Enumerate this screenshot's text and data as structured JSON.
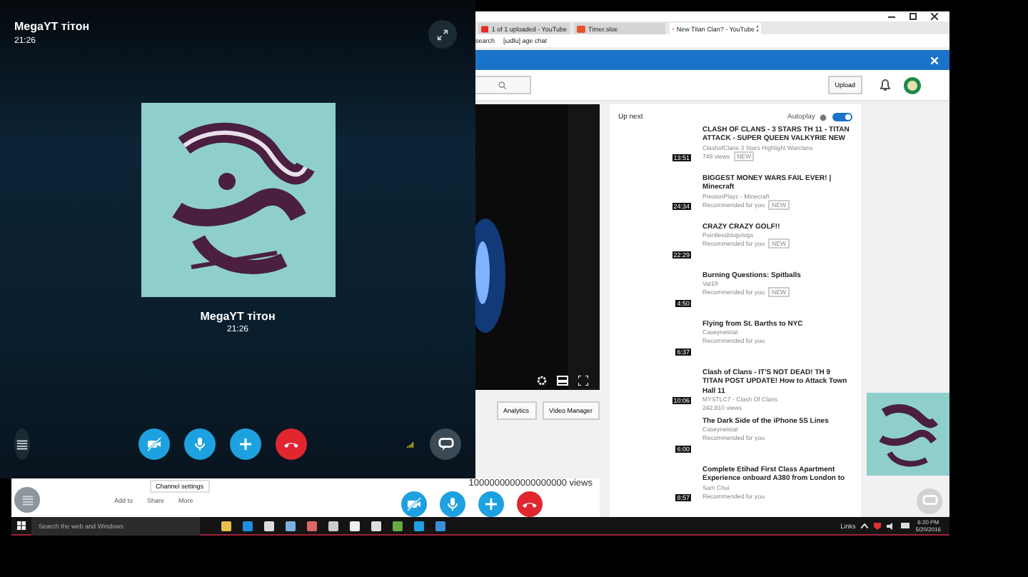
{
  "call": {
    "title": "MegaYT тітон",
    "time": "21:26",
    "name": "MegaYT тітон",
    "elapsed": "21:26",
    "camera_off": true,
    "mic_muted": false
  },
  "browser": {
    "tabs": [
      {
        "label": "1 of 1 uploaded - YouTube",
        "selected": false
      },
      {
        "label": "Timer.sloe",
        "selected": false
      },
      {
        "label": "New Titan Clan? - YouTube",
        "selected": true
      }
    ],
    "bookmarks": [
      "search",
      "[ωdlu] age chat"
    ],
    "youtube": {
      "upload": "Upload",
      "studio_buttons": [
        "Analytics",
        "Video Manager"
      ],
      "channel_settings": "Channel settings",
      "views": "1000000000000000000 views",
      "actions": [
        "Add to",
        "Share",
        "More"
      ],
      "up_next": {
        "title": "Up next",
        "autoplay": {
          "label": "Autoplay",
          "on": true
        },
        "videos": [
          {
            "title": "CLASH OF CLANS - 3 STARS TH 11 - TITAN ATTACK - SUPER QUEEN VALKYRIE NEW",
            "channel": "ClashofClans 3 Stars Highlight Warclans",
            "meta": "749 views",
            "badge": "NEW",
            "duration": "13:51"
          },
          {
            "title": "BIGGEST MONEY WARS FAIL EVER! | Minecraft",
            "channel": "PrestonPlayz - Minecraft",
            "meta": "Recommended for you",
            "badge": "NEW",
            "duration": "24:34"
          },
          {
            "title": "CRAZY CRAZY GOLF!!",
            "channel": "Pointlessblogvlogs",
            "meta": "Recommended for you",
            "badge": "NEW",
            "duration": "22:29"
          },
          {
            "title": "Burning Questions: Spitballs",
            "channel": "Vat19",
            "meta": "Recommended for you",
            "badge": "NEW",
            "duration": "4:50"
          },
          {
            "title": "Flying from St. Barths to NYC",
            "channel": "Caseyneistat",
            "meta": "Recommended for you",
            "duration": "6:37"
          },
          {
            "title": "Clash of Clans - IT'S NOT DEAD! TH 9 TITAN POST UPDATE! How to Attack Town Hall 11",
            "channel": "MYSTLC7 - Clash Of Clans",
            "meta": "242,810 views",
            "duration": "10:06"
          },
          {
            "title": "The Dark Side of the iPhone 5S Lines",
            "channel": "Caseyneistat",
            "meta": "Recommended for you",
            "duration": "6:00"
          },
          {
            "title": "Complete Etihad First Class Apartment Experience onboard A380 from London to",
            "channel": "Sam Chui",
            "meta": "Recommended for you",
            "duration": "8:57"
          }
        ]
      }
    }
  },
  "overlay_call": {
    "camera_off": true,
    "mic_muted": false
  },
  "taskbar": {
    "search_placeholder": "Search the web and Windows",
    "links": "Links",
    "time": "6:20 PM",
    "date": "5/20/2016"
  }
}
